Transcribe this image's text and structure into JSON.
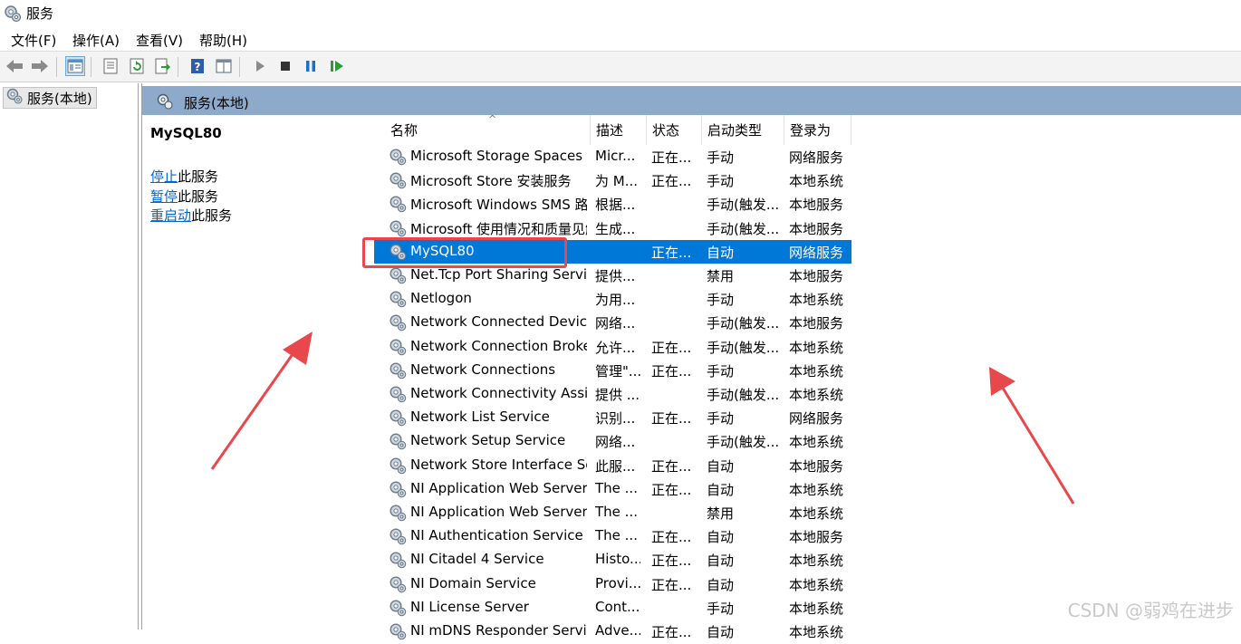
{
  "window": {
    "title": "服务"
  },
  "menu": [
    "文件(F)",
    "操作(A)",
    "查看(V)",
    "帮助(H)"
  ],
  "toolbar": {
    "icons": [
      "back-arrow-icon",
      "forward-arrow-icon",
      "console-tree-icon",
      "properties-icon",
      "refresh-icon",
      "export-icon",
      "help-icon",
      "show-hide-pane-icon",
      "start-icon",
      "stop-icon",
      "pause-icon",
      "resume-icon"
    ]
  },
  "tree": {
    "item": "服务(本地)"
  },
  "main": {
    "header": "服务(本地)",
    "selected_title": "MySQL80",
    "actions": [
      {
        "link": "停止",
        "rest": "此服务"
      },
      {
        "link": "暂停",
        "rest": "此服务"
      },
      {
        "link": "重启动",
        "rest": "此服务"
      }
    ]
  },
  "table": {
    "columns": [
      "名称",
      "描述",
      "状态",
      "启动类型",
      "登录为"
    ],
    "rows": [
      [
        "Microsoft Storage Spaces SMP",
        "Micr...",
        "正在...",
        "手动",
        "网络服务"
      ],
      [
        "Microsoft Store 安装服务",
        "为 M...",
        "正在...",
        "手动",
        "本地系统"
      ],
      [
        "Microsoft Windows SMS 路由器服务",
        "根据...",
        "",
        "手动(触发...",
        "本地服务"
      ],
      [
        "Microsoft 使用情况和质量见解",
        "生成...",
        "",
        "手动(触发...",
        "本地服务"
      ],
      [
        "MySQL80",
        "",
        "正在...",
        "自动",
        "网络服务"
      ],
      [
        "Net.Tcp Port Sharing Service",
        "提供...",
        "",
        "禁用",
        "本地服务"
      ],
      [
        "Netlogon",
        "为用...",
        "",
        "手动",
        "本地系统"
      ],
      [
        "Network Connected Devices Auto-Setup",
        "网络...",
        "",
        "手动(触发...",
        "本地服务"
      ],
      [
        "Network Connection Broker",
        "允许...",
        "正在...",
        "手动(触发...",
        "本地系统"
      ],
      [
        "Network Connections",
        "管理\"...",
        "正在...",
        "手动",
        "本地系统"
      ],
      [
        "Network Connectivity Assistant",
        "提供 ...",
        "",
        "手动(触发...",
        "本地系统"
      ],
      [
        "Network List Service",
        "识别...",
        "正在...",
        "手动",
        "网络服务"
      ],
      [
        "Network Setup Service",
        "网络...",
        "",
        "手动(触发...",
        "本地系统"
      ],
      [
        "Network Store Interface Service",
        "此服...",
        "正在...",
        "自动",
        "本地服务"
      ],
      [
        "NI Application Web Server",
        "The ...",
        "正在...",
        "自动",
        "本地系统"
      ],
      [
        "NI Application Web Server (Legacy)",
        "The ...",
        "",
        "禁用",
        "本地系统"
      ],
      [
        "NI Authentication Service",
        "The ...",
        "正在...",
        "自动",
        "本地服务"
      ],
      [
        "NI Citadel 4 Service",
        "Histo...",
        "正在...",
        "自动",
        "本地系统"
      ],
      [
        "NI Domain Service",
        "Provi...",
        "正在...",
        "自动",
        "本地系统"
      ],
      [
        "NI License Server",
        "Cont...",
        "",
        "手动",
        "本地系统"
      ],
      [
        "NI mDNS Responder Service",
        "Adve...",
        "正在...",
        "自动",
        "本地系统"
      ]
    ],
    "selected_index": 4
  },
  "colors": {
    "selection": "#0078d7",
    "header_band": "#8eaacb",
    "highlight_box": "#e8474c",
    "arrow": "#e8474c"
  },
  "watermark": "CSDN @弱鸡在进步"
}
